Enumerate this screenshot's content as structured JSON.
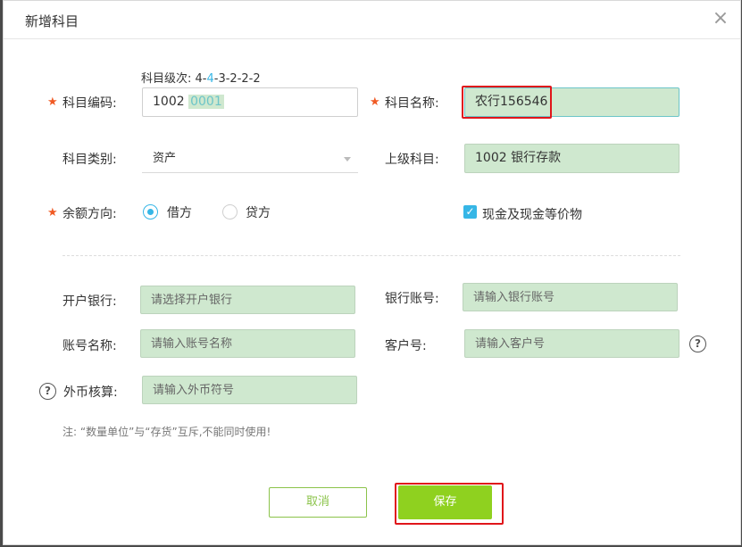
{
  "dialog": {
    "title": "新增科目",
    "close_glyph": "×"
  },
  "level_hint": {
    "prefix": "科目级次:  4-",
    "highlight": "4",
    "suffix": "-3-2-2-2"
  },
  "form": {
    "required_mark": "★",
    "code": {
      "label": "科目编码:",
      "prefix": "1002",
      "suffix": "0001"
    },
    "name": {
      "label": "科目名称:",
      "value": "农行156546"
    },
    "category": {
      "label": "科目类别:",
      "value": "资产"
    },
    "parent": {
      "label": "上级科目:",
      "value": "1002 银行存款"
    },
    "balance_direction": {
      "label": "余额方向:",
      "options": [
        "借方",
        "贷方"
      ],
      "selected": "借方"
    },
    "cash_equivalent": {
      "label": "现金及现金等价物",
      "checked": true,
      "check_glyph": "✓"
    },
    "bank": {
      "label": "开户银行:",
      "placeholder": "请选择开户银行"
    },
    "account_no": {
      "label": "银行账号:",
      "placeholder": "请输入银行账号"
    },
    "account_name": {
      "label": "账号名称:",
      "placeholder": "请输入账号名称"
    },
    "customer_no": {
      "label": "客户号:",
      "placeholder": "请输入客户号"
    },
    "foreign_currency": {
      "label": "外币核算:",
      "placeholder": "请输入外币符号"
    },
    "help_glyph": "?",
    "note": "注:  “数量单位”与“存货”互斥,不能同时使用!"
  },
  "buttons": {
    "cancel": "取消",
    "save": "保存"
  },
  "colors": {
    "accent_blue": "#36b6e6",
    "brand_green": "#8fd11f",
    "highlight_red": "#e0151a",
    "input_green": "#cfe8cf"
  }
}
